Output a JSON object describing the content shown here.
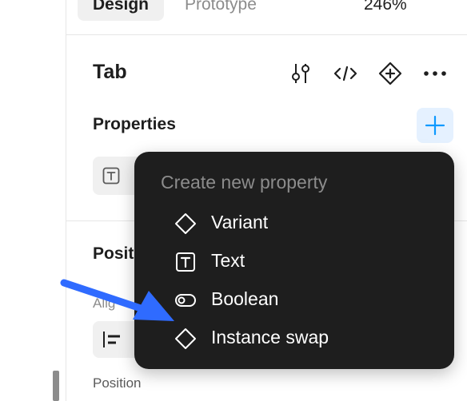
{
  "tabs": {
    "design": "Design",
    "prototype": "Prototype"
  },
  "zoom": {
    "value": "246%",
    "icon": "chevron-down-icon"
  },
  "component": {
    "title": "Tab",
    "tools": [
      "adjust-sliders-icon",
      "code-icon",
      "component-diamond-icon",
      "more-icon"
    ]
  },
  "properties": {
    "label": "Properties",
    "add_icon": "plus-icon",
    "row_icon": "text-property-icon"
  },
  "position_section": {
    "title": "Posit",
    "alignment_label": "Alig",
    "position_label": "Position"
  },
  "menu": {
    "header": "Create new property",
    "items": [
      {
        "label": "Variant",
        "icon": "diamond-icon"
      },
      {
        "label": "Text",
        "icon": "text-box-icon"
      },
      {
        "label": "Boolean",
        "icon": "toggle-icon"
      },
      {
        "label": "Instance swap",
        "icon": "diamond-icon"
      }
    ]
  },
  "colors": {
    "accent": "#0d99ff",
    "menu_bg": "#1e1e1e",
    "arrow": "#2f6bff"
  }
}
